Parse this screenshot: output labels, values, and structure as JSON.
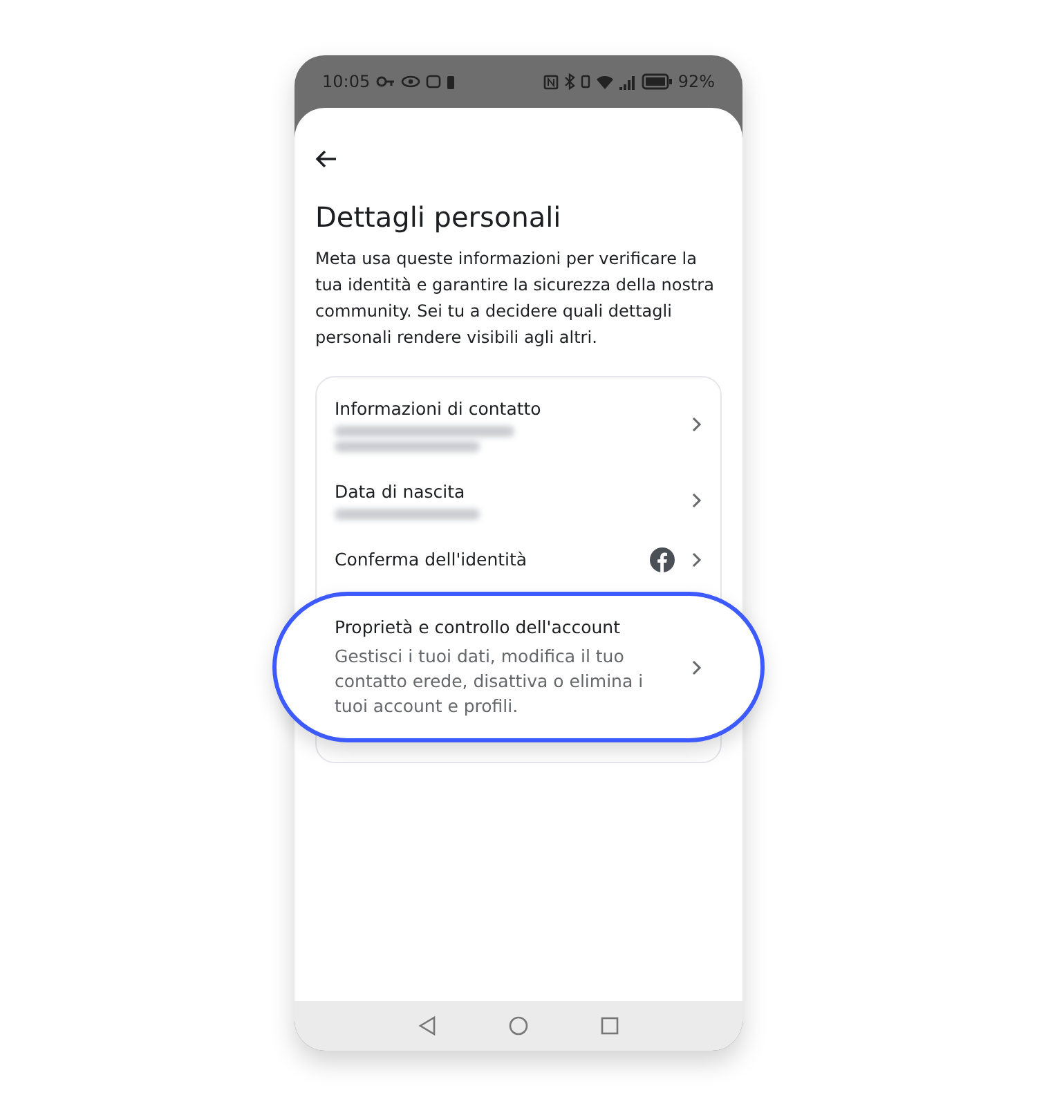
{
  "status_bar": {
    "time": "10:05",
    "battery": "92%"
  },
  "header": {
    "title": "Dettagli personali",
    "description": "Meta usa queste informazioni per verificare la tua identità e garantire la sicurezza della nostra community. Sei tu a decidere quali dettagli personali rendere visibili agli altri."
  },
  "items": [
    {
      "kind": "blurred-two-lines",
      "title": "Informazioni di contatto",
      "selected": false
    },
    {
      "kind": "blurred-one-line",
      "title": "Data di nascita",
      "selected": false
    },
    {
      "kind": "facebook",
      "title": "Conferma dell'identità",
      "selected": false
    },
    {
      "kind": "description",
      "title": "Proprietà e controllo dell'account",
      "description": "Gestisci i tuoi dati, modifica il tuo contatto erede, disattiva o elimina i tuoi account e profili.",
      "selected": true
    }
  ]
}
